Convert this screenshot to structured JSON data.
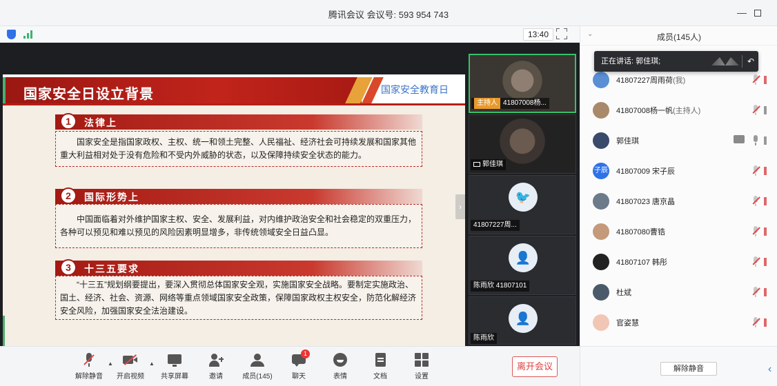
{
  "window": {
    "title": "腾讯会议 会议号: 593 954 743",
    "minimize_label": "—"
  },
  "status": {
    "time": "13:40"
  },
  "slide": {
    "title": "国家安全日设立背景",
    "tag": "国家安全教育日",
    "sections": [
      {
        "num": "1",
        "heading": "法律上",
        "text": "国家安全是指国家政权、主权、统一和领土完整、人民福祉、经济社会可持续发展和国家其他重大利益相对处于没有危险和不受内外威胁的状态，以及保障持续安全状态的能力。"
      },
      {
        "num": "2",
        "heading": "国际形势上",
        "text": "中国面临着对外维护国家主权、安全、发展利益，对内维护政治安全和社会稳定的双重压力，各种可以预见和难以预见的风险因素明显增多，非传统领域安全日益凸显。"
      },
      {
        "num": "3",
        "heading": "十三五要求",
        "text": "“十三五”规划纲要提出，要深入贯彻总体国家安全观，实施国家安全战略。要制定实施政治、国土、经济、社会、资源、网络等重点领域国家安全政策，保障国家政权主权安全，防范化解经济安全风险，加强国家安全法治建设。"
      }
    ]
  },
  "tiles": [
    {
      "host_label": "主持人",
      "name": "41807008杨..."
    },
    {
      "name": "郭佳琪"
    },
    {
      "name": "41807227周..."
    },
    {
      "name": "陈雨欣 41807101"
    },
    {
      "name": "陈雨欣"
    }
  ],
  "toolbar": {
    "items": [
      {
        "label": "解除静音"
      },
      {
        "label": "开启视频"
      },
      {
        "label": "共享屏幕"
      },
      {
        "label": "邀请"
      },
      {
        "label": "成员(145)"
      },
      {
        "label": "聊天",
        "badge": "1"
      },
      {
        "label": "表情"
      },
      {
        "label": "文档"
      },
      {
        "label": "设置"
      }
    ],
    "leave_label": "离开会议"
  },
  "panel": {
    "title": "成员(145人)",
    "speaking": "正在讲话: 郭佳琪;",
    "members": [
      {
        "name": "41807227周雨荷",
        "sub": "(我)",
        "avatar": ""
      },
      {
        "name": "41807008杨一帆",
        "sub": "(主持人)",
        "avatar": ""
      },
      {
        "name": "郭佳琪",
        "sub": "",
        "avatar": ""
      },
      {
        "name": "41807009 宋子辰",
        "sub": "",
        "avatar": "子辰"
      },
      {
        "name": "41807023 唐京晶",
        "sub": "",
        "avatar": ""
      },
      {
        "name": "41807080曹锆",
        "sub": "",
        "avatar": ""
      },
      {
        "name": "41807107 韩彤",
        "sub": "",
        "avatar": ""
      },
      {
        "name": "杜斌",
        "sub": "",
        "avatar": ""
      },
      {
        "name": "官姿慧",
        "sub": "",
        "avatar": ""
      }
    ],
    "unmute_all_label": "解除静音"
  },
  "colors": {
    "accent": "#2f72e8",
    "leave": "#e03e3e",
    "slide_red": "#b51f17",
    "active_border": "#37c26a"
  }
}
